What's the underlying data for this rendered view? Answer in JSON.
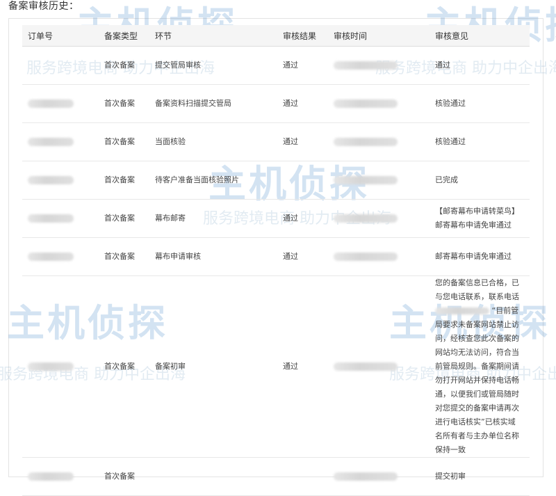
{
  "page": {
    "section_title": "备案审核历史："
  },
  "table": {
    "headers": [
      "订单号",
      "备案类型",
      "环节",
      "审核结果",
      "审核时间",
      "审核意见"
    ],
    "rows": [
      {
        "order": "",
        "type": "首次备案",
        "step": "提交管局审核",
        "result": "通过",
        "time": "",
        "opinion": "通过"
      },
      {
        "order": "",
        "type": "首次备案",
        "step": "备案资料扫描提交管局",
        "result": "通过",
        "time": "",
        "opinion": "核验通过"
      },
      {
        "order": "",
        "type": "首次备案",
        "step": "当面核验",
        "result": "通过",
        "time": "",
        "opinion": "核验通过"
      },
      {
        "order": "",
        "type": "首次备案",
        "step": "待客户准备当面核验照片",
        "result": "",
        "time": "",
        "opinion": "已完成"
      },
      {
        "order": "",
        "type": "首次备案",
        "step": "幕布邮寄",
        "result": "通过",
        "time": "",
        "opinion": "【邮寄幕布申请转菜鸟】邮寄幕布申请免审通过"
      },
      {
        "order": "",
        "type": "首次备案",
        "step": "幕布申请审核",
        "result": "通过",
        "time": "",
        "opinion": "邮寄幕布申请免审通过"
      },
      {
        "order": "",
        "type": "首次备案",
        "step": "备案初审",
        "result": "通过",
        "time": "",
        "opinion_a": "您的备案信息已合格，已与您电话联系，联系电话",
        "opinion_b": "“目前管局要求未备案网站禁止访问，经核查您此次备案的网站均无法访问，符合当前管局规则。备案期间请勿打开网站并保持电话畅通，以便我们或管局随时对您提交的备案申请再次进行电话核实”已核实域名所有者与主办单位名称保持一致"
      },
      {
        "order": "",
        "type": "首次备案",
        "step": "",
        "result": "",
        "time": "",
        "opinion": "提交初审"
      }
    ]
  },
  "watermarks": {
    "brand": "主机侦探",
    "slogan": "服务跨境电商 助力中企出海",
    "brand_color": "#3d84c6",
    "accent_color": "#f5a623"
  }
}
